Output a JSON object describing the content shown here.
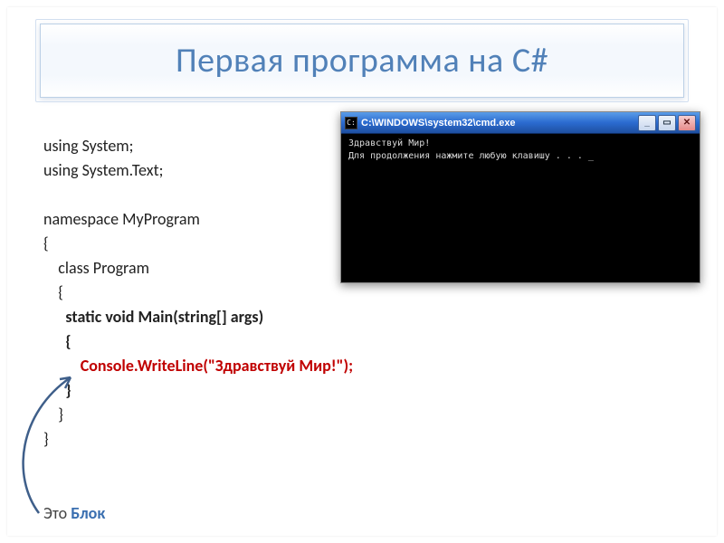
{
  "title": "Первая программа на С#",
  "code": {
    "l1": "using System;",
    "l2": "using System.Text;",
    "l3": "",
    "l4": "namespace MyProgram",
    "l5": "{",
    "l6": "    class Program",
    "l7": "    {",
    "l8": "      static void Main(string[] args)",
    "l9": "      {",
    "l10": "          Console.WriteLine(\"Здравствуй Мир!\");",
    "l11": "      }",
    "l12": "    }",
    "l13": "}"
  },
  "footer": {
    "plain": "Это ",
    "blue": "Блок"
  },
  "console": {
    "title": " C:\\WINDOWS\\system32\\cmd.exe",
    "min": "_",
    "max": "▭",
    "close": "✕",
    "line1": "Здравствуй Мир!",
    "line2": "Для продолжения нажмите любую клавишу . . . _"
  }
}
